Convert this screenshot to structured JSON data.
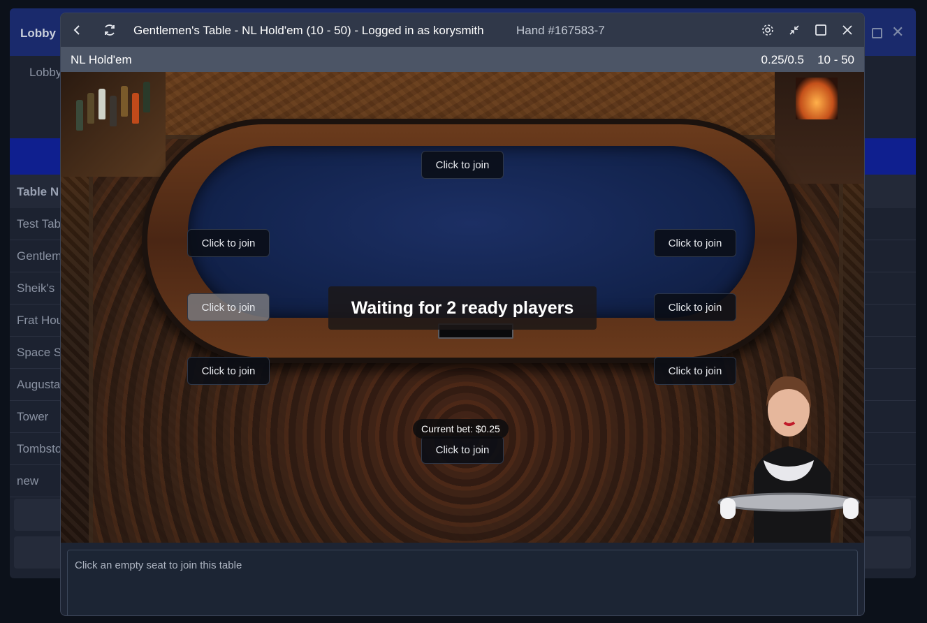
{
  "lobby": {
    "title": "Lobby",
    "tab": "Lobby",
    "header": "Table N",
    "rows": [
      "Test Tab",
      "Gentlem",
      "Sheik's",
      "Frat Hou",
      "Space S",
      "Augusta",
      "Tower",
      "Tombsto",
      "new"
    ]
  },
  "window": {
    "title": "Gentlemen's Table - NL Hold'em (10 - 50) - Logged in as korysmith",
    "hand": "Hand #167583-7"
  },
  "infobar": {
    "game": "NL Hold'em",
    "stakes": "0.25/0.5",
    "limits": "10 - 50"
  },
  "seats": [
    {
      "label": "Click to join"
    },
    {
      "label": "Click to join"
    },
    {
      "label": "Click to join"
    },
    {
      "label": "Click to join"
    },
    {
      "label": "Click to join"
    },
    {
      "label": "Click to join"
    },
    {
      "label": "Click to join"
    },
    {
      "label": "Click to join"
    }
  ],
  "table": {
    "status": "Waiting for 2 ready players",
    "current_bet": "Current bet: $0.25"
  },
  "message": "Click an empty seat to join this table",
  "icons": {
    "back": "back-icon",
    "refresh": "refresh-icon",
    "settings": "gear-icon",
    "minimize": "minimize-icon",
    "maximize": "maximize-icon",
    "close": "close-icon"
  },
  "colors": {
    "titlebar": "#303849",
    "infobar": "#4c5566",
    "felt": "#13244f",
    "lobby_title": "#1a2a6c"
  }
}
